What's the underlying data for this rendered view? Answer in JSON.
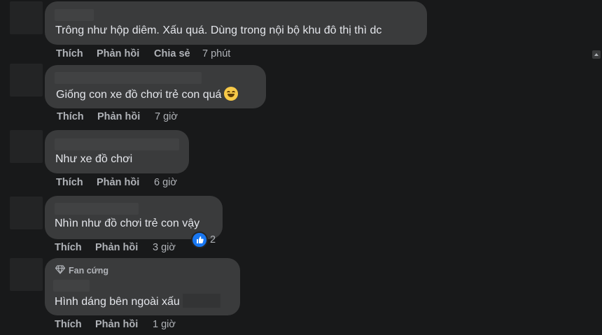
{
  "comments": [
    {
      "text": "Trông như hộp diêm. Xấu quá. Dùng trong nội bộ khu đô thị thì dc",
      "actions": [
        "Thích",
        "Phản hồi",
        "Chia sẻ"
      ],
      "time": "7 phút"
    },
    {
      "text": "Giống con xe đồ chơi trẻ con quá",
      "emoji": "grinning-face-emoji",
      "actions": [
        "Thích",
        "Phản hồi"
      ],
      "time": "7 giờ"
    },
    {
      "text": "Như xe đồ chơi",
      "actions": [
        "Thích",
        "Phản hồi"
      ],
      "time": "6 giờ"
    },
    {
      "text": "Nhìn như đồ chơi trẻ con vậy",
      "actions": [
        "Thích",
        "Phản hồi"
      ],
      "time": "3 giờ",
      "reaction": {
        "icon": "like-icon",
        "count": "2"
      }
    },
    {
      "badge": "Fan cứng",
      "text": "Hình dáng bên ngoài xấu",
      "actions": [
        "Thích",
        "Phản hồi"
      ],
      "time": "1 giờ"
    }
  ],
  "colors": {
    "background": "#18191a",
    "bubble": "#3a3b3c",
    "text": "#e4e6eb",
    "secondary_text": "#b0b3b8",
    "like_blue": "#1877f2"
  }
}
